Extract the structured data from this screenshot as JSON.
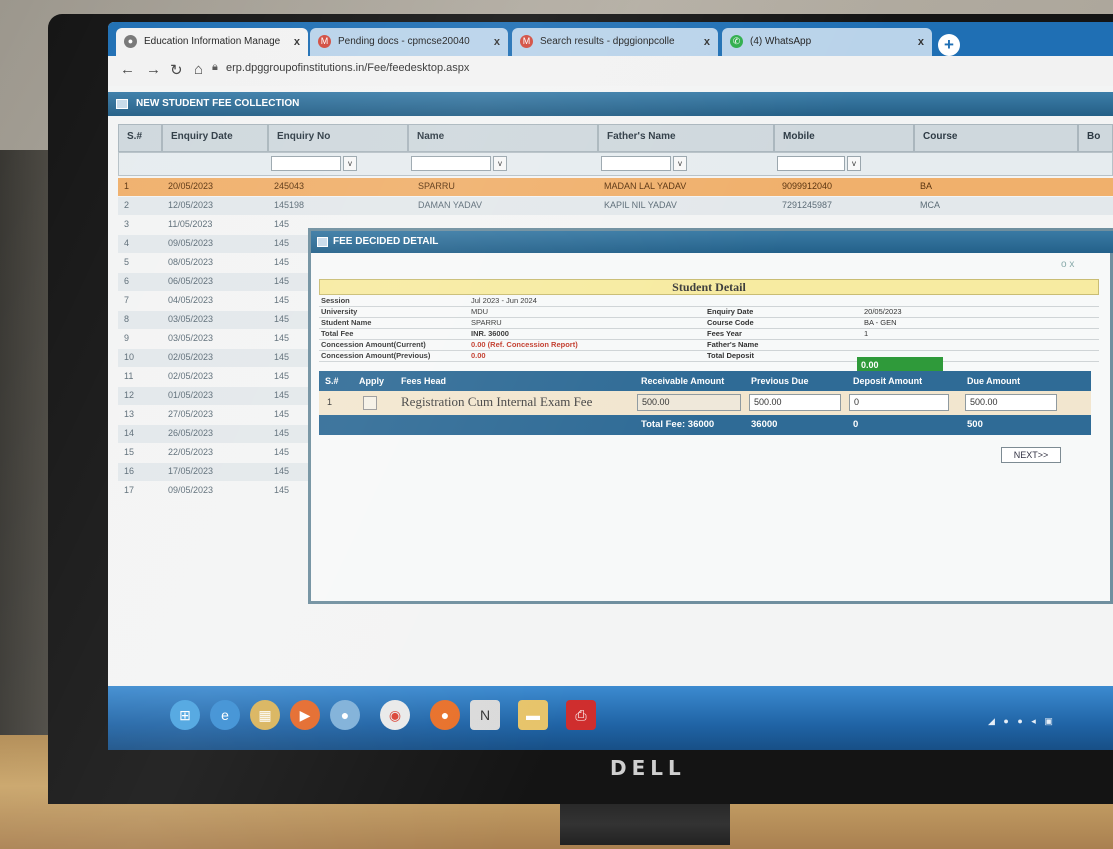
{
  "browser": {
    "tabs": [
      {
        "title": "Education Information Manage",
        "icon": "globe-icon",
        "close": "x",
        "active": true
      },
      {
        "title": "Pending docs - cpmcse20040",
        "icon": "gmail-icon",
        "close": "x",
        "active": false
      },
      {
        "title": "Search results - dpggionpcolle",
        "icon": "gmail-icon",
        "close": "x",
        "active": false
      },
      {
        "title": "(4) WhatsApp",
        "icon": "whatsapp-icon",
        "close": "x",
        "active": false
      }
    ],
    "new_tab": "+",
    "url": "erp.dpggroupofinstitutions.in/Fee/feedesktop.aspx"
  },
  "page": {
    "header": "NEW STUDENT FEE COLLECTION",
    "grid": {
      "columns": [
        "S.#",
        "Enquiry Date",
        "Enquiry No",
        "Name",
        "Father's Name",
        "Mobile",
        "Course",
        "Bo"
      ],
      "filter_button": "v",
      "rows": [
        {
          "sno": "1",
          "date": "20/05/2023",
          "no": "245043",
          "name": "SPARRU",
          "father": "MADAN LAL YADAV",
          "mobile": "9099912040",
          "course": "BA"
        },
        {
          "sno": "2",
          "date": "12/05/2023",
          "no": "145198",
          "name": "DAMAN YADAV",
          "father": "KAPIL NIL YADAV",
          "mobile": "7291245987",
          "course": "MCA"
        },
        {
          "sno": "3",
          "date": "11/05/2023",
          "no": "145",
          "name": "",
          "father": "",
          "mobile": "",
          "course": ""
        },
        {
          "sno": "4",
          "date": "09/05/2023",
          "no": "145",
          "name": "",
          "father": "",
          "mobile": "",
          "course": ""
        },
        {
          "sno": "5",
          "date": "08/05/2023",
          "no": "145",
          "name": "",
          "father": "",
          "mobile": "",
          "course": ""
        },
        {
          "sno": "6",
          "date": "06/05/2023",
          "no": "145",
          "name": "",
          "father": "",
          "mobile": "",
          "course": ""
        },
        {
          "sno": "7",
          "date": "04/05/2023",
          "no": "145",
          "name": "",
          "father": "",
          "mobile": "",
          "course": ""
        },
        {
          "sno": "8",
          "date": "03/05/2023",
          "no": "145",
          "name": "",
          "father": "",
          "mobile": "",
          "course": ""
        },
        {
          "sno": "9",
          "date": "03/05/2023",
          "no": "145",
          "name": "",
          "father": "",
          "mobile": "",
          "course": ""
        },
        {
          "sno": "10",
          "date": "02/05/2023",
          "no": "145",
          "name": "",
          "father": "",
          "mobile": "",
          "course": ""
        },
        {
          "sno": "11",
          "date": "02/05/2023",
          "no": "145",
          "name": "",
          "father": "",
          "mobile": "",
          "course": ""
        },
        {
          "sno": "12",
          "date": "01/05/2023",
          "no": "145",
          "name": "",
          "father": "",
          "mobile": "",
          "course": ""
        },
        {
          "sno": "13",
          "date": "27/05/2023",
          "no": "145",
          "name": "",
          "father": "",
          "mobile": "",
          "course": ""
        },
        {
          "sno": "14",
          "date": "26/05/2023",
          "no": "145",
          "name": "",
          "father": "",
          "mobile": "",
          "course": ""
        },
        {
          "sno": "15",
          "date": "22/05/2023",
          "no": "145",
          "name": "",
          "father": "",
          "mobile": "",
          "course": ""
        },
        {
          "sno": "16",
          "date": "17/05/2023",
          "no": "145",
          "name": "",
          "father": "",
          "mobile": "",
          "course": ""
        },
        {
          "sno": "17",
          "date": "09/05/2023",
          "no": "145",
          "name": "",
          "father": "",
          "mobile": "",
          "course": ""
        }
      ]
    }
  },
  "modal": {
    "title": "FEE DECIDED DETAIL",
    "controls": "o x",
    "student_detail": {
      "heading": "Student Detail",
      "left": [
        {
          "label": "Session",
          "value": "Jul 2023 - Jun 2024"
        },
        {
          "label": "University",
          "value": "MDU"
        },
        {
          "label": "Student Name",
          "value": "SPARRU"
        },
        {
          "label": "Total Fee",
          "value": "INR. 36000"
        },
        {
          "label": "Concession Amount(Current)",
          "value": "0.00 (Ref. Concession Report)"
        },
        {
          "label": "Concession Amount(Previous)",
          "value": "0.00"
        }
      ],
      "right": [
        {
          "label": "Enquiry Date",
          "value": "20/05/2023"
        },
        {
          "label": "Course Code",
          "value": "BA - GEN"
        },
        {
          "label": "Fees Year",
          "value": "1"
        },
        {
          "label": "Father's Name",
          "value": ""
        },
        {
          "label": "Total Deposit",
          "value": ""
        }
      ],
      "total_deposit": "0.00"
    },
    "fee_table": {
      "headers": [
        "S.#",
        "Apply",
        "Fees Head",
        "Receivable Amount",
        "Previous Due",
        "Deposit Amount",
        "Due Amount"
      ],
      "rows": [
        {
          "sno": "1",
          "apply": "",
          "head": "Registration Cum Internal Exam Fee",
          "receivable": "500.00",
          "previous_due": "500.00",
          "deposit": "0",
          "due": "500.00"
        }
      ],
      "totals": {
        "label": "Total Fee: 36000",
        "previous_due": "36000",
        "deposit": "0",
        "due": "500"
      }
    },
    "next_button": "NEXT>>"
  },
  "taskbar": {
    "icons": [
      "windows-start-icon",
      "ie-icon",
      "explorer-icon",
      "media-icon",
      "app-icon",
      "chrome-icon",
      "firefox-icon",
      "notes-icon",
      "folder-icon",
      "pdf-icon"
    ]
  },
  "monitor": {
    "brand": "DELL"
  }
}
